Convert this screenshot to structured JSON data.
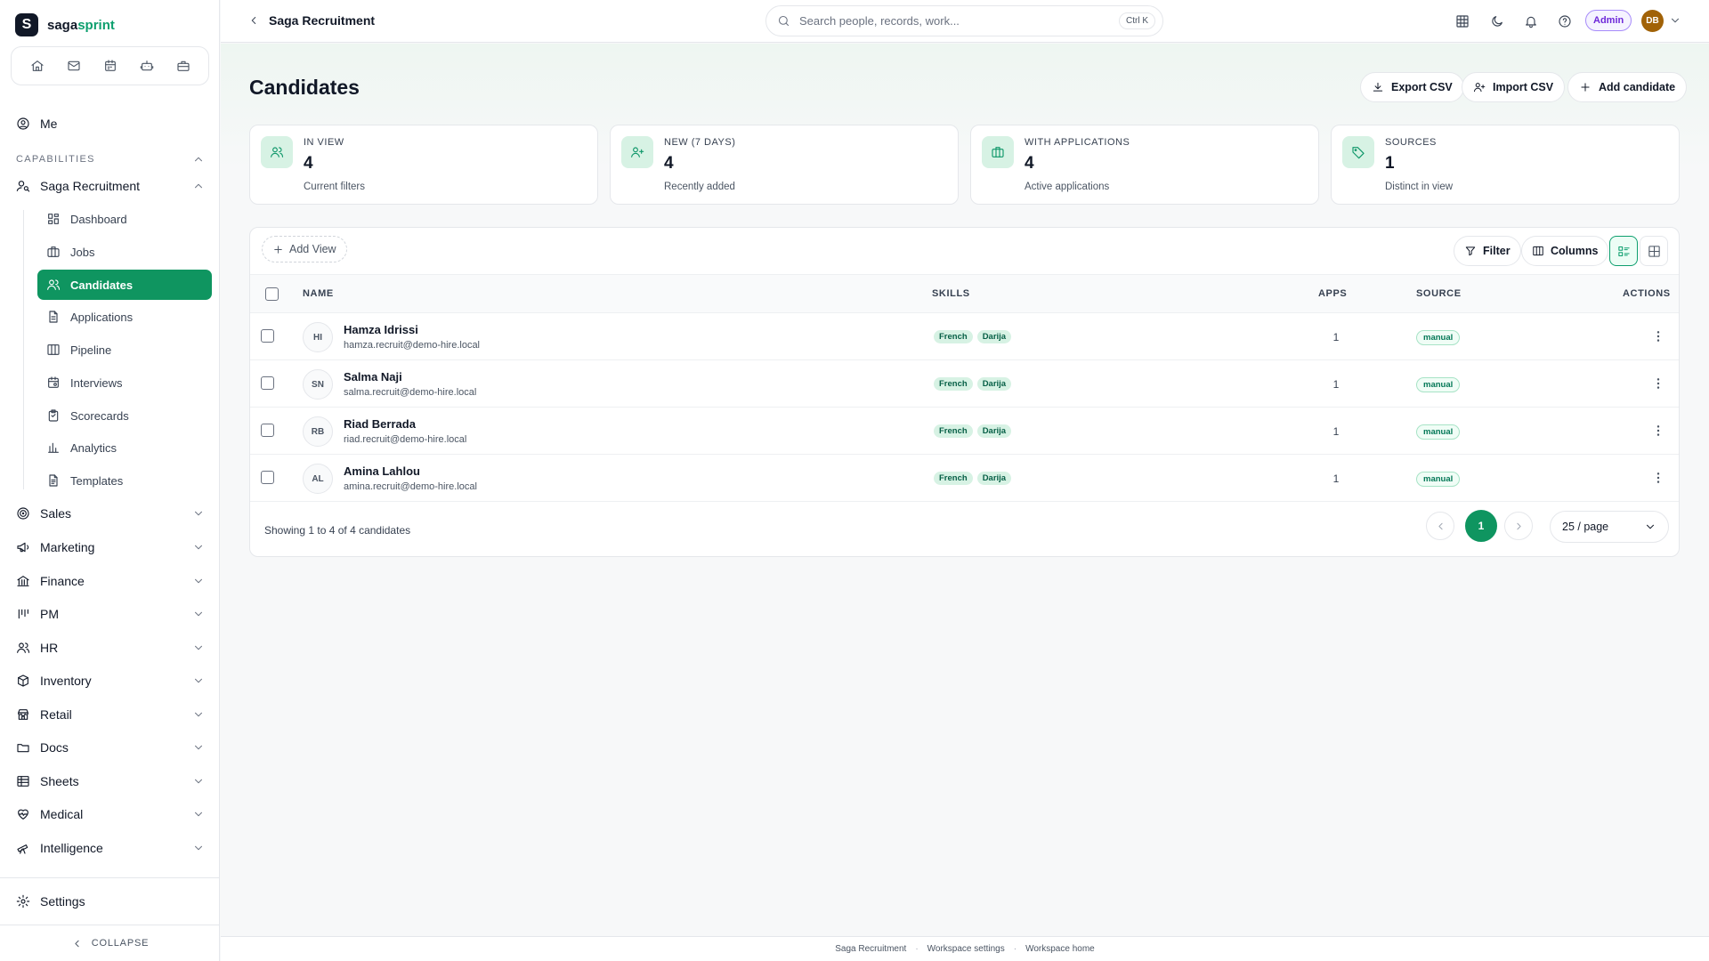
{
  "brand": {
    "logo_letter": "S",
    "name_part1": "saga",
    "name_part2": "sprint"
  },
  "sidebar": {
    "me": "Me",
    "capabilities_label": "CAPABILITIES",
    "recruitment_group": "Saga Recruitment",
    "sub_items": [
      {
        "label": "Dashboard",
        "icon": "dashboard-icon"
      },
      {
        "label": "Jobs",
        "icon": "briefcase-icon"
      },
      {
        "label": "Candidates",
        "icon": "users-icon",
        "active": true
      },
      {
        "label": "Applications",
        "icon": "file-icon"
      },
      {
        "label": "Pipeline",
        "icon": "columns-icon"
      },
      {
        "label": "Interviews",
        "icon": "calendar-icon"
      },
      {
        "label": "Scorecards",
        "icon": "clipboard-icon"
      },
      {
        "label": "Analytics",
        "icon": "bar-chart-icon"
      },
      {
        "label": "Templates",
        "icon": "file-text-icon"
      }
    ],
    "groups": [
      "Sales",
      "Marketing",
      "Finance",
      "PM",
      "HR",
      "Inventory",
      "Retail",
      "Docs",
      "Sheets",
      "Medical",
      "Intelligence"
    ],
    "settings": "Settings",
    "collapse": "COLLAPSE"
  },
  "topbar": {
    "breadcrumb": "Saga Recruitment",
    "search_placeholder": "Search people, records, work...",
    "search_shortcut": "Ctrl K",
    "admin_badge": "Admin",
    "avatar_initials": "DB"
  },
  "page": {
    "title": "Candidates",
    "export_label": "Export CSV",
    "import_label": "Import CSV",
    "add_label": "Add candidate"
  },
  "stats": [
    {
      "label": "IN VIEW",
      "value": "4",
      "sub": "Current filters"
    },
    {
      "label": "NEW (7 DAYS)",
      "value": "4",
      "sub": "Recently added"
    },
    {
      "label": "WITH APPLICATIONS",
      "value": "4",
      "sub": "Active applications"
    },
    {
      "label": "SOURCES",
      "value": "1",
      "sub": "Distinct in view"
    }
  ],
  "toolbar": {
    "add_view": "Add View",
    "filter": "Filter",
    "columns": "Columns"
  },
  "table": {
    "headers": {
      "name": "NAME",
      "skills": "SKILLS",
      "apps": "APPS",
      "source": "SOURCE",
      "actions": "ACTIONS"
    },
    "rows": [
      {
        "initials": "HI",
        "name": "Hamza Idrissi",
        "email": "hamza.recruit@demo-hire.local",
        "skills": [
          "French",
          "Darija"
        ],
        "apps": "1",
        "source": "manual"
      },
      {
        "initials": "SN",
        "name": "Salma Naji",
        "email": "salma.recruit@demo-hire.local",
        "skills": [
          "French",
          "Darija"
        ],
        "apps": "1",
        "source": "manual"
      },
      {
        "initials": "RB",
        "name": "Riad Berrada",
        "email": "riad.recruit@demo-hire.local",
        "skills": [
          "French",
          "Darija"
        ],
        "apps": "1",
        "source": "manual"
      },
      {
        "initials": "AL",
        "name": "Amina Lahlou",
        "email": "amina.recruit@demo-hire.local",
        "skills": [
          "French",
          "Darija"
        ],
        "apps": "1",
        "source": "manual"
      }
    ],
    "footer_text": "Showing 1 to 4 of 4 candidates",
    "current_page": "1",
    "per_page": "25 / page"
  },
  "footer": {
    "links": [
      "Saga Recruitment",
      "Workspace settings",
      "Workspace home"
    ],
    "separator": "·"
  },
  "colors": {
    "accent": "#0f9560",
    "accent_soft": "#d7f2e4",
    "admin": "#6d28d9"
  }
}
